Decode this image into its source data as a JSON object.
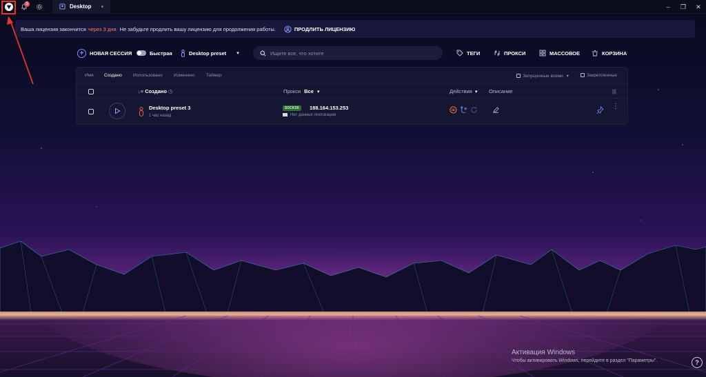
{
  "titlebar": {
    "tab_label": "Desktop",
    "notification_count": "3",
    "window_controls": {
      "minimize": "–",
      "maximize": "❐",
      "close": "✕"
    }
  },
  "banner": {
    "text_before": "Ваша лицензия закончится",
    "highlight": "через 3 дня.",
    "text_after": "Не забудьте продлить вашу лицензию для продолжения работы.",
    "renew_label": "ПРОДЛИТЬ ЛИЦЕНЗИЮ"
  },
  "toolbar": {
    "new_session": "НОВАЯ СЕССИЯ",
    "quick_label": "Быстрая",
    "preset_label": "Desktop preset",
    "search_placeholder": "Ищите все, что хотите",
    "tags": "ТЕГИ",
    "proxies": "ПРОКСИ",
    "bulk": "МАССОВОЕ",
    "trash": "КОРЗИНА"
  },
  "filters": {
    "tabs": [
      "Имя",
      "Создано",
      "Использовано",
      "Изменено",
      "Таймер"
    ],
    "active_tab": "Создано",
    "running_all": "Запущенные всеми",
    "pinned": "Закрепленные"
  },
  "table_header": {
    "created": "Создано",
    "proxy": "Прокси",
    "proxy_filter": "Все",
    "actions": "Действия",
    "description": "Описание"
  },
  "rows": [
    {
      "name": "Desktop preset 3",
      "created_ago": "1 час назад",
      "proxy_type": "SOCKS5",
      "ip": "188.164.153.253",
      "geo": "Нет данных геолокации"
    }
  ],
  "watermark": {
    "title": "Активация Windows",
    "subtitle": "Чтобы активировать Windows, перейдите в раздел \"Параметры\"."
  },
  "help_label": "?",
  "colors": {
    "accent": "#7d8cff",
    "highlight": "#ff7a5e",
    "annotation": "#e3372b",
    "panel": "#141632"
  }
}
